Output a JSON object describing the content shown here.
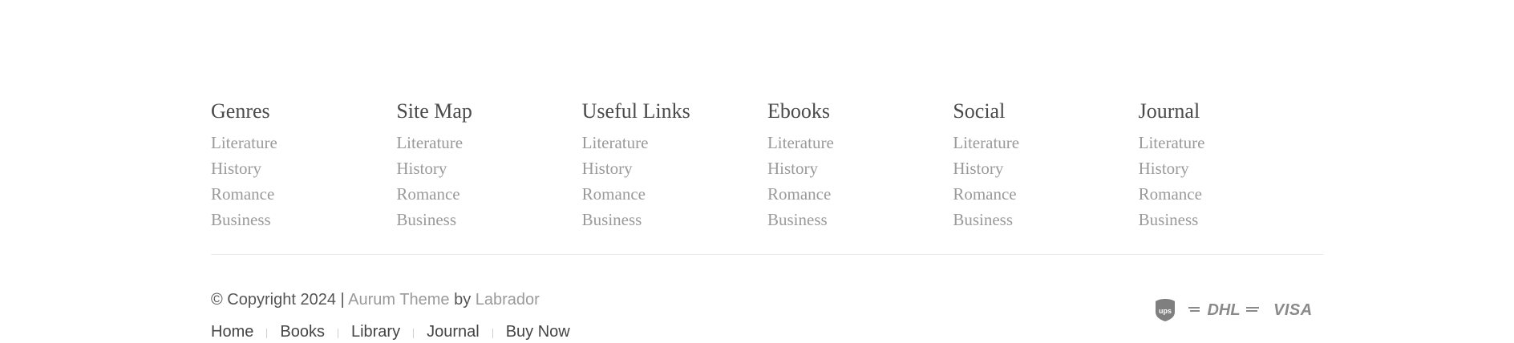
{
  "footer": {
    "columns": [
      {
        "title": "Genres",
        "items": [
          "Literature",
          "History",
          "Romance",
          "Business"
        ]
      },
      {
        "title": "Site Map",
        "items": [
          "Literature",
          "History",
          "Romance",
          "Business"
        ]
      },
      {
        "title": "Useful Links",
        "items": [
          "Literature",
          "History",
          "Romance",
          "Business"
        ]
      },
      {
        "title": "Ebooks",
        "items": [
          "Literature",
          "History",
          "Romance",
          "Business"
        ]
      },
      {
        "title": "Social",
        "items": [
          "Literature",
          "History",
          "Romance",
          "Business"
        ]
      },
      {
        "title": "Journal",
        "items": [
          "Literature",
          "History",
          "Romance",
          "Business"
        ]
      }
    ]
  },
  "copyright": {
    "prefix": "© Copyright 2024 |",
    "theme_link": "Aurum Theme",
    "by": "by",
    "author_link": "Labrador"
  },
  "bottom_nav": {
    "items": [
      "Home",
      "Books",
      "Library",
      "Journal",
      "Buy Now"
    ]
  },
  "payments": {
    "ups_label": "ups",
    "dhl_label": "DHL",
    "visa_label": "VISA",
    "icons": [
      "ups-icon",
      "dhl-icon",
      "visa-icon"
    ]
  },
  "colors": {
    "heading": "#4a4a4a",
    "link": "#9a9a9a",
    "text": "#555555",
    "divider": "#ececec"
  }
}
